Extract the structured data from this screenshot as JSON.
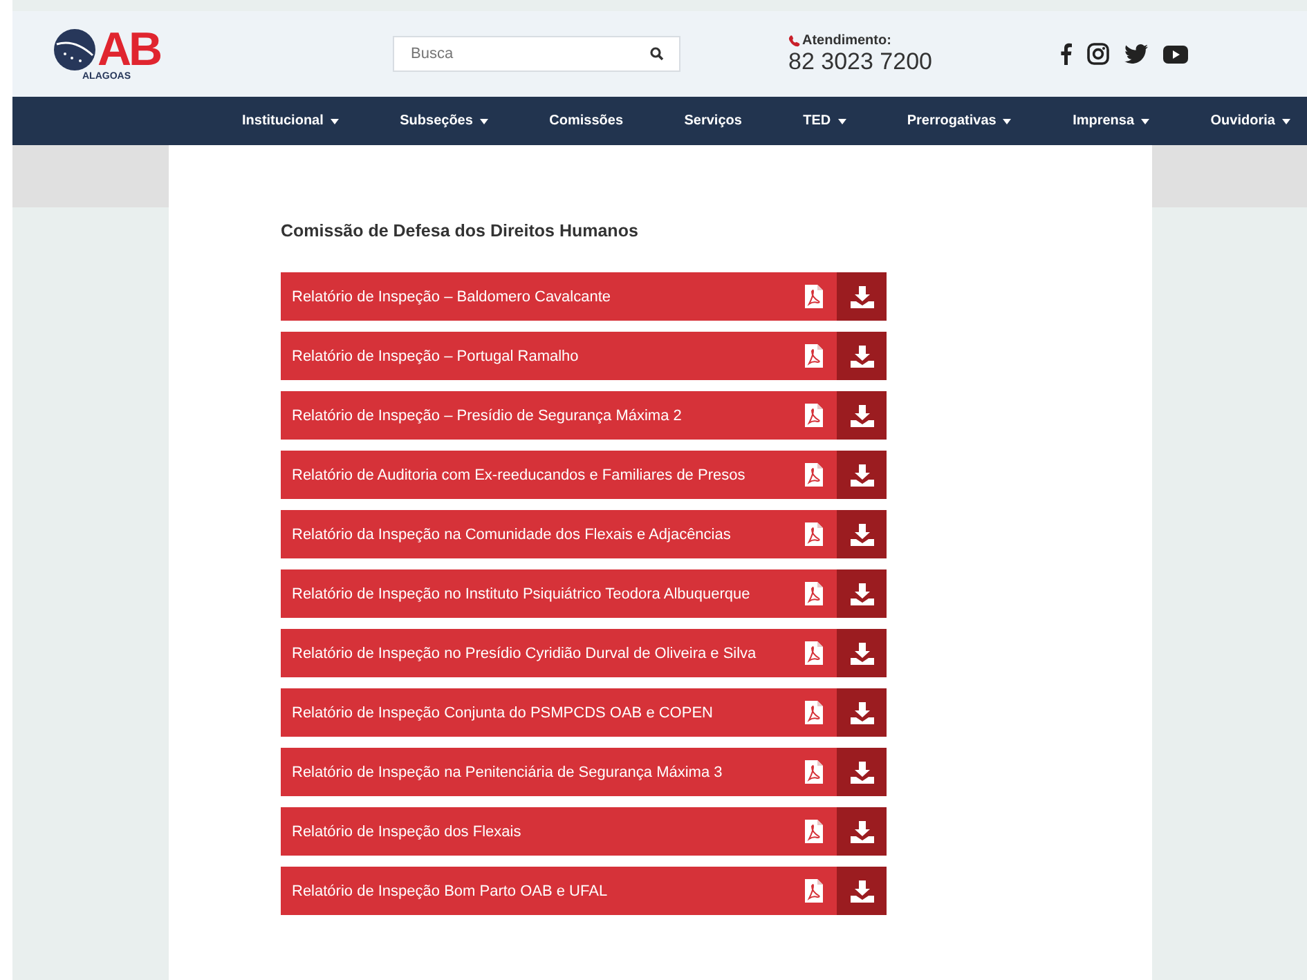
{
  "logo": {
    "letters": "AB",
    "region": "ALAGOAS"
  },
  "search": {
    "placeholder": "Busca"
  },
  "contact": {
    "label": "Atendimento:",
    "phone": "82 3023 7200"
  },
  "nav": [
    {
      "label": "Institucional",
      "dropdown": true
    },
    {
      "label": "Subseções",
      "dropdown": true
    },
    {
      "label": "Comissões",
      "dropdown": false
    },
    {
      "label": "Serviços",
      "dropdown": false
    },
    {
      "label": "TED",
      "dropdown": true
    },
    {
      "label": "Prerrogativas",
      "dropdown": true
    },
    {
      "label": "Imprensa",
      "dropdown": true
    },
    {
      "label": "Ouvidoria",
      "dropdown": true
    }
  ],
  "section_title": "Comissão de Defesa dos Direitos Humanos",
  "documents": [
    {
      "title": "Relatório de Inspeção – Baldomero Cavalcante"
    },
    {
      "title": "Relatório de Inspeção – Portugal Ramalho"
    },
    {
      "title": "Relatório de Inspeção – Presídio de Segurança Máxima 2"
    },
    {
      "title": "Relatório de Auditoria com Ex-reeducandos e Familiares de Presos"
    },
    {
      "title": "Relatório da Inspeção na Comunidade dos Flexais e Adjacências"
    },
    {
      "title": "Relatório de Inspeção no Instituto Psiquiátrico Teodora Albuquerque"
    },
    {
      "title": "Relatório de Inspeção no Presídio Cyridião Durval de Oliveira e Silva"
    },
    {
      "title": "Relatório de Inspeção Conjunta do PSMPCDS OAB e COPEN"
    },
    {
      "title": "Relatório de Inspeção na Penitenciária de Segurança Máxima 3"
    },
    {
      "title": "Relatório de Inspeção dos Flexais"
    },
    {
      "title": "Relatório de Inspeção Bom Parto OAB e UFAL"
    }
  ]
}
